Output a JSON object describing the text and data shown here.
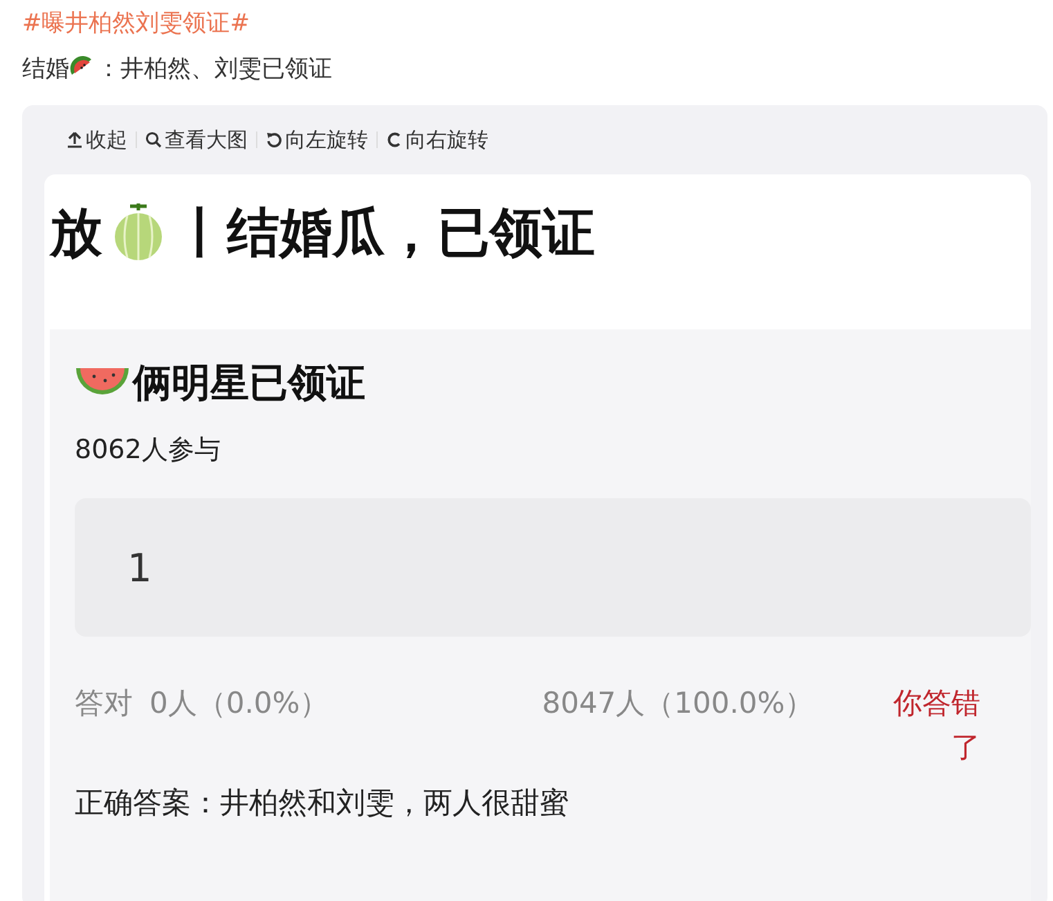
{
  "hashtag": "#曝井柏然刘雯领证#",
  "post_text": {
    "before_icon": "结婚",
    "after_icon": "：井柏然、刘雯已领证"
  },
  "toolbar": [
    {
      "kind": "collapse",
      "label": "收起"
    },
    {
      "kind": "zoom",
      "label": "查看大图"
    },
    {
      "kind": "rotate_left",
      "label": "向左旋转"
    },
    {
      "kind": "rotate_right",
      "label": "向右旋转"
    }
  ],
  "card": {
    "title_before_icon": "放",
    "title_after_icon": "丨结婚瓜，已领证",
    "quiz": {
      "title": "俩明星已领证",
      "participants": "8062人参与",
      "options": [
        {
          "label": "1"
        }
      ],
      "correct_label": "答对",
      "correct_count": "0人（0.0%）",
      "wrong_count": "8047人（100.0%）",
      "result": "你答错了",
      "answer": "正确答案：井柏然和刘雯，两人很甜蜜"
    }
  }
}
